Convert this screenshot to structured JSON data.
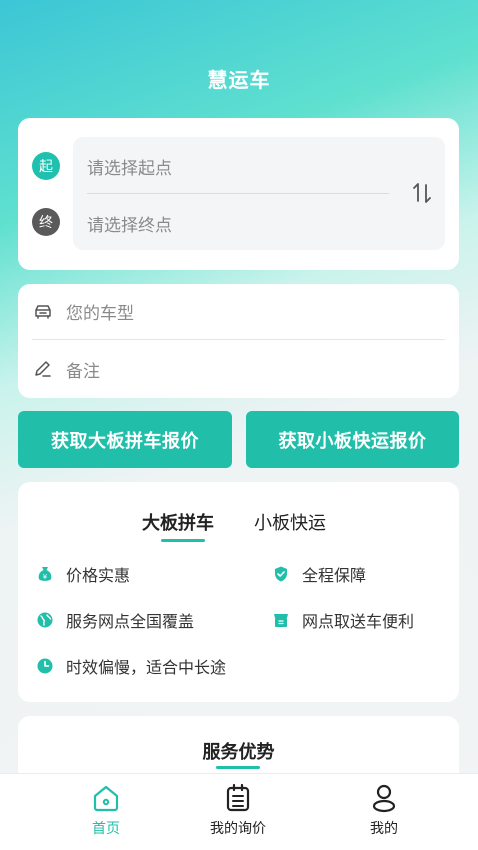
{
  "header": {
    "title": "慧运车"
  },
  "route": {
    "start_badge": "起",
    "start_placeholder": "请选择起点",
    "end_badge": "终",
    "end_placeholder": "请选择终点"
  },
  "info": {
    "car_type_placeholder": "您的车型",
    "note_placeholder": "备注"
  },
  "actions": {
    "big_board_quote": "获取大板拼车报价",
    "small_board_quote": "获取小板快运报价"
  },
  "service_tabs": {
    "tabs": [
      "大板拼车",
      "小板快运"
    ],
    "active": "大板拼车",
    "features": [
      {
        "icon": "money-bag-icon",
        "label": "价格实惠"
      },
      {
        "icon": "shield-check-icon",
        "label": "全程保障"
      },
      {
        "icon": "globe-icon",
        "label": "服务网点全国覆盖"
      },
      {
        "icon": "store-icon",
        "label": "网点取送车便利"
      },
      {
        "icon": "clock-icon",
        "label": "时效偏慢，适合中长途"
      }
    ]
  },
  "advantages": {
    "title": "服务优势"
  },
  "bottom_nav": {
    "items": [
      {
        "label": "首页",
        "icon": "home-icon",
        "active": true
      },
      {
        "label": "我的询价",
        "icon": "clipboard-icon",
        "active": false
      },
      {
        "label": "我的",
        "icon": "user-icon",
        "active": false
      }
    ]
  },
  "colors": {
    "accent": "#21bfa9",
    "header_gradient_start": "#3cc6d6",
    "header_gradient_end": "#5fe0cf"
  }
}
